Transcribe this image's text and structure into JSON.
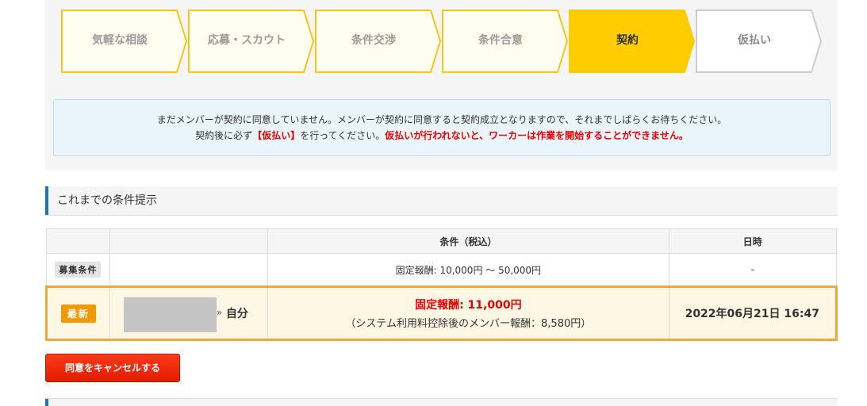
{
  "steps": [
    {
      "label": "気軽な相談",
      "state": "done"
    },
    {
      "label": "応募・スカウト",
      "state": "done"
    },
    {
      "label": "条件交渉",
      "state": "done"
    },
    {
      "label": "条件合意",
      "state": "done"
    },
    {
      "label": "契約",
      "state": "active"
    },
    {
      "label": "仮払い",
      "state": "upcoming"
    }
  ],
  "notice": {
    "line1": "まだメンバーが契約に同意していません。メンバーが契約に同意すると契約成立となりますので、それまでしばらくお待ちください。",
    "line2_pre": "契約後に必ず",
    "line2_emph": "【仮払い】",
    "line2_mid": "を行ってください。",
    "line2_warn": "仮払いが行われないと、ワーカーは作業を開始することができません。"
  },
  "section": {
    "title": "これまでの条件提示"
  },
  "table": {
    "headers": {
      "col1": "",
      "col2": "",
      "conditions": "条件（税込）",
      "datetime": "日時"
    },
    "recruit_row": {
      "tag": "募集条件",
      "member": "",
      "conditions": "固定報酬: 10,000円 〜 50,000円",
      "datetime": "-"
    },
    "latest_row": {
      "tag": "最新",
      "arrow": "»",
      "self_label": "自分",
      "price": "固定報酬: 11,000円",
      "price_note": "（システム利用料控除後のメンバー報酬：8,580円）",
      "datetime": "2022年06月21日 16:47"
    }
  },
  "cancel_button": {
    "label": "同意をキャンセルする"
  },
  "colors": {
    "step_done_fill": "#fefef0",
    "step_done_border": "#f5c518",
    "step_active_fill": "#ffcc00",
    "step_upcoming_border": "#cccccc",
    "accent_blue": "#1a73c9",
    "highlight_border": "#f0a83a",
    "alert_red": "#e60000"
  }
}
